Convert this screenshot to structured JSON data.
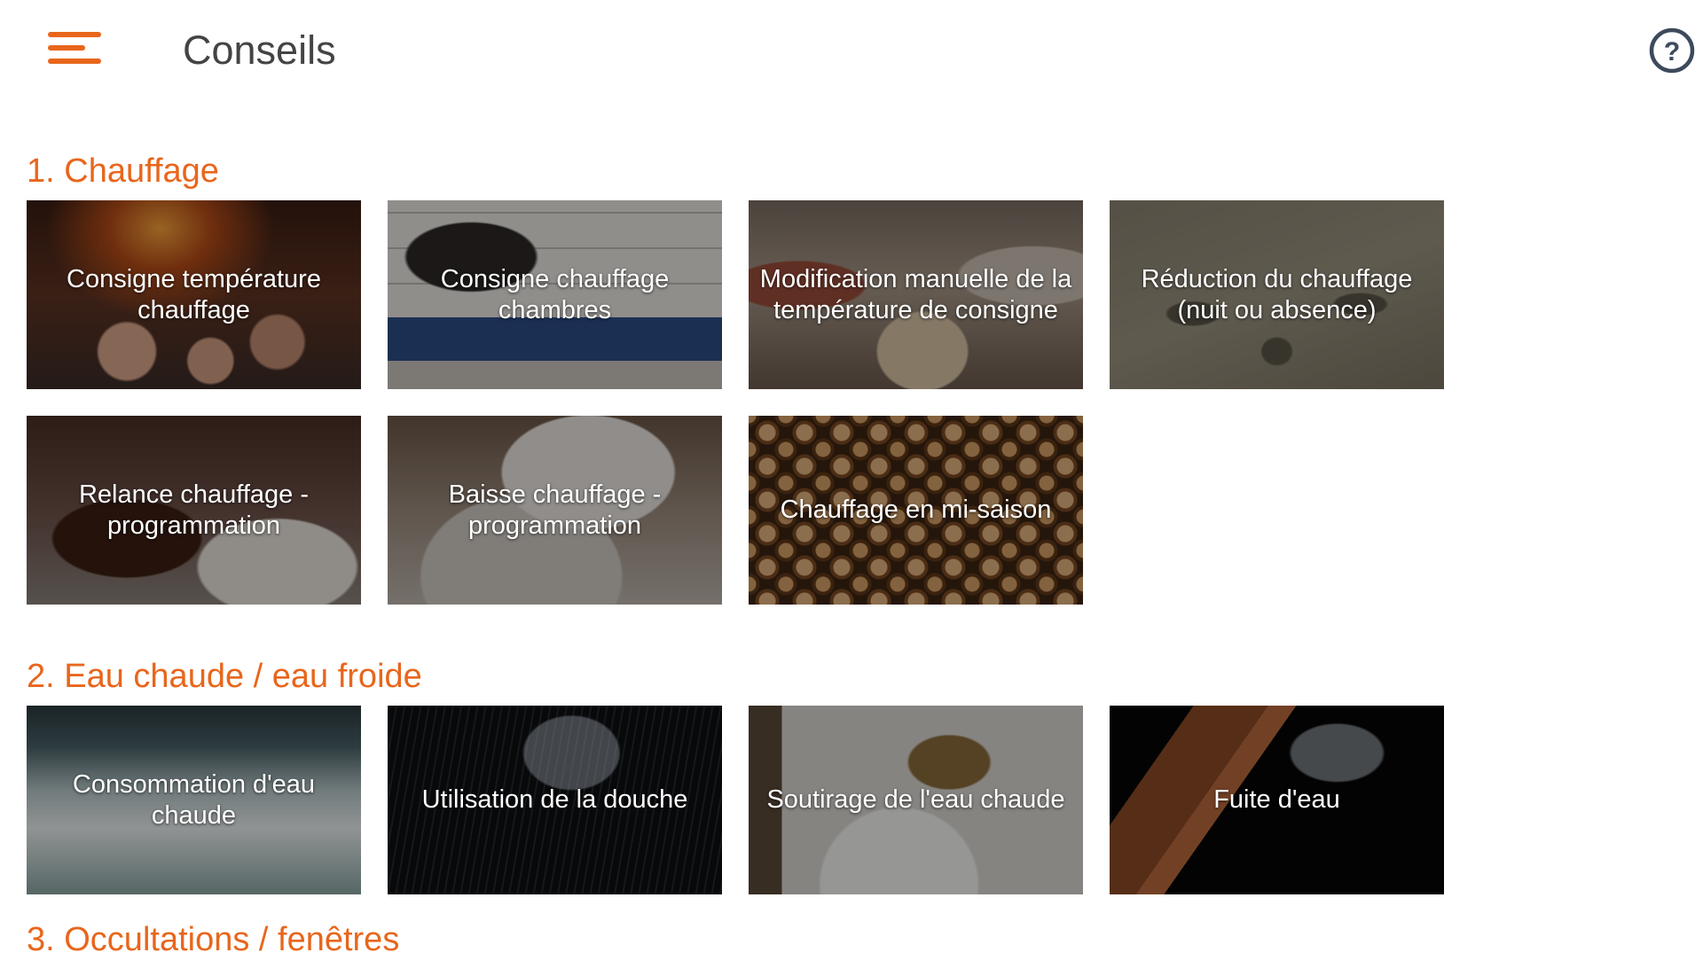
{
  "header": {
    "title": "Conseils",
    "menu_icon": "menu-icon",
    "help_icon": "help-icon",
    "help_symbol": "?"
  },
  "colors": {
    "accent": "#e8661c",
    "title": "#444444",
    "help_icon": "#3d4a5c"
  },
  "sections": [
    {
      "title": "1. Chauffage",
      "tiles": [
        {
          "label": "Consigne température chauffage"
        },
        {
          "label": "Consigne chauffage chambres"
        },
        {
          "label": "Modification manuelle de la température de consigne"
        },
        {
          "label": "Réduction du chauffage (nuit ou absence)"
        },
        {
          "label": "Relance chauffage - programmation"
        },
        {
          "label": "Baisse chauffage - programmation"
        },
        {
          "label": "Chauffage en mi-saison"
        }
      ]
    },
    {
      "title": "2. Eau chaude / eau froide",
      "tiles": [
        {
          "label": "Consommation d'eau chaude"
        },
        {
          "label": "Utilisation de la douche"
        },
        {
          "label": "Soutirage de l'eau chaude"
        },
        {
          "label": "Fuite d'eau"
        }
      ]
    },
    {
      "title": "3. Occultations / fenêtres",
      "tiles": []
    }
  ]
}
